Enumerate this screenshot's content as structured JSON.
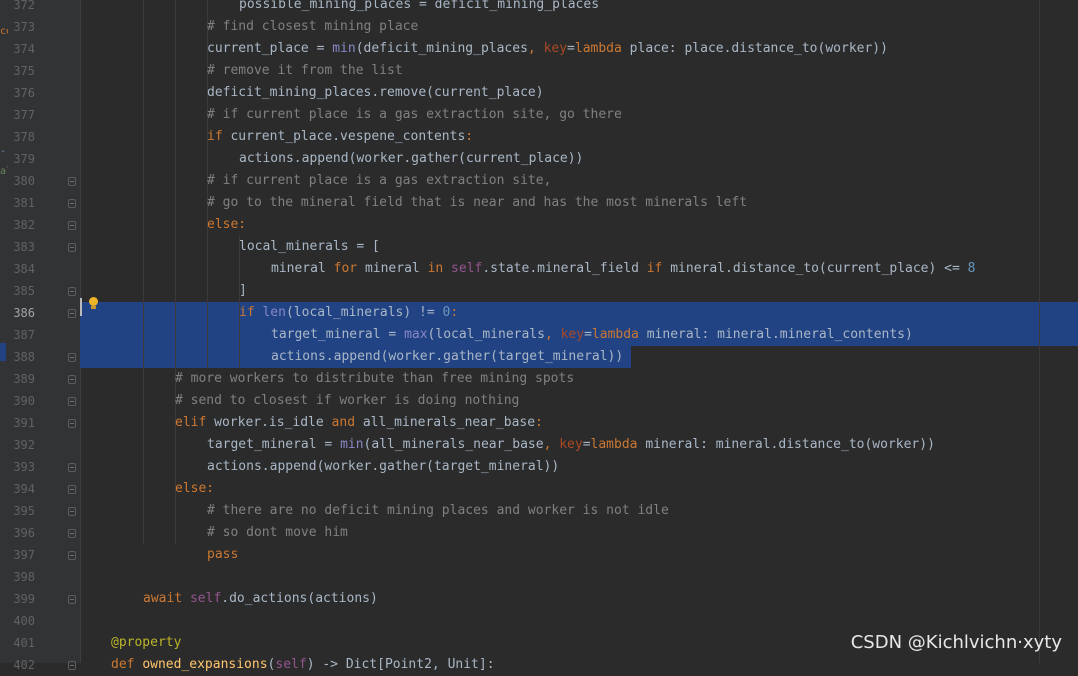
{
  "editor": {
    "current_line": 386,
    "lines": [
      {
        "n": 372,
        "indent": 4,
        "fold": false,
        "tokens": [
          [
            "",
            "possible_mining_places = deficit_mining_places"
          ]
        ]
      },
      {
        "n": 373,
        "indent": 3,
        "fold": false,
        "tokens": [
          [
            "cm",
            "# find closest mining place"
          ]
        ]
      },
      {
        "n": 374,
        "indent": 3,
        "fold": false,
        "tokens": [
          [
            "",
            "current_place = "
          ],
          [
            "fn",
            "min"
          ],
          [
            "",
            "(deficit_mining_places"
          ],
          [
            "kw",
            ", "
          ],
          [
            "pm",
            "key"
          ],
          [
            "",
            "="
          ],
          [
            "kw",
            "lambda "
          ],
          [
            "",
            "place: place.distance_to(worker))"
          ]
        ]
      },
      {
        "n": 375,
        "indent": 3,
        "fold": false,
        "tokens": [
          [
            "cm",
            "# remove it from the list"
          ]
        ]
      },
      {
        "n": 376,
        "indent": 3,
        "fold": false,
        "tokens": [
          [
            "",
            "deficit_mining_places.remove(current_place)"
          ]
        ]
      },
      {
        "n": 377,
        "indent": 3,
        "fold": false,
        "tokens": [
          [
            "cm",
            "# if current place is a gas extraction site, go there"
          ]
        ]
      },
      {
        "n": 378,
        "indent": 3,
        "fold": false,
        "tokens": [
          [
            "kw",
            "if "
          ],
          [
            "",
            "current_place.vespene_contents"
          ],
          [
            "kw",
            ":"
          ]
        ]
      },
      {
        "n": 379,
        "indent": 4,
        "fold": false,
        "tokens": [
          [
            "",
            "actions.append(worker.gather(current_place))"
          ]
        ]
      },
      {
        "n": 380,
        "indent": 3,
        "fold": true,
        "tokens": [
          [
            "cm",
            "# if current place is a gas extraction site,"
          ]
        ]
      },
      {
        "n": 381,
        "indent": 3,
        "fold": true,
        "tokens": [
          [
            "cm",
            "# go to the mineral field that is near and has the most minerals left"
          ]
        ]
      },
      {
        "n": 382,
        "indent": 3,
        "fold": true,
        "tokens": [
          [
            "kw",
            "else:"
          ]
        ]
      },
      {
        "n": 383,
        "indent": 4,
        "fold": true,
        "tokens": [
          [
            "",
            "local_minerals = ["
          ]
        ]
      },
      {
        "n": 384,
        "indent": 5,
        "fold": false,
        "tokens": [
          [
            "",
            "mineral "
          ],
          [
            "kw",
            "for "
          ],
          [
            "",
            "mineral "
          ],
          [
            "kw",
            "in "
          ],
          [
            "sf",
            "self"
          ],
          [
            "",
            ".state.mineral_field "
          ],
          [
            "kw",
            "if "
          ],
          [
            "",
            "mineral.distance_to(current_place) <= "
          ],
          [
            "num",
            "8"
          ]
        ]
      },
      {
        "n": 385,
        "indent": 4,
        "fold": true,
        "tokens": [
          [
            "",
            "]"
          ]
        ]
      },
      {
        "n": 386,
        "indent": 4,
        "fold": true,
        "tokens": [
          [
            "kw",
            "if "
          ],
          [
            "fn",
            "len"
          ],
          [
            "",
            "(local_minerals) != "
          ],
          [
            "num",
            "0"
          ],
          [
            "kw",
            ":"
          ]
        ]
      },
      {
        "n": 387,
        "indent": 5,
        "fold": false,
        "tokens": [
          [
            "",
            "target_mineral = "
          ],
          [
            "fn",
            "max"
          ],
          [
            "",
            "(local_minerals"
          ],
          [
            "kw",
            ", "
          ],
          [
            "pm",
            "key"
          ],
          [
            "",
            "="
          ],
          [
            "kw",
            "lambda "
          ],
          [
            "",
            "mineral: mineral.mineral_contents)"
          ]
        ]
      },
      {
        "n": 388,
        "indent": 5,
        "fold": true,
        "tokens": [
          [
            "",
            "actions.append(worker.gather(target_mineral))"
          ]
        ]
      },
      {
        "n": 389,
        "indent": 2,
        "fold": true,
        "tokens": [
          [
            "cm",
            "# more workers to distribute than free mining spots"
          ]
        ]
      },
      {
        "n": 390,
        "indent": 2,
        "fold": true,
        "tokens": [
          [
            "cm",
            "# send to closest if worker is doing nothing"
          ]
        ]
      },
      {
        "n": 391,
        "indent": 2,
        "fold": true,
        "tokens": [
          [
            "kw",
            "elif "
          ],
          [
            "",
            "worker.is_idle "
          ],
          [
            "kw",
            "and "
          ],
          [
            "",
            "all_minerals_near_base"
          ],
          [
            "kw",
            ":"
          ]
        ]
      },
      {
        "n": 392,
        "indent": 3,
        "fold": false,
        "tokens": [
          [
            "",
            "target_mineral = "
          ],
          [
            "fn",
            "min"
          ],
          [
            "",
            "(all_minerals_near_base"
          ],
          [
            "kw",
            ", "
          ],
          [
            "pm",
            "key"
          ],
          [
            "",
            "="
          ],
          [
            "kw",
            "lambda "
          ],
          [
            "",
            "mineral: mineral.distance_to(worker))"
          ]
        ]
      },
      {
        "n": 393,
        "indent": 3,
        "fold": true,
        "tokens": [
          [
            "",
            "actions.append(worker.gather(target_mineral))"
          ]
        ]
      },
      {
        "n": 394,
        "indent": 2,
        "fold": true,
        "tokens": [
          [
            "kw",
            "else:"
          ]
        ]
      },
      {
        "n": 395,
        "indent": 3,
        "fold": true,
        "tokens": [
          [
            "cm",
            "# there are no deficit mining places and worker is not idle"
          ]
        ]
      },
      {
        "n": 396,
        "indent": 3,
        "fold": true,
        "tokens": [
          [
            "cm",
            "# so dont move him"
          ]
        ]
      },
      {
        "n": 397,
        "indent": 3,
        "fold": true,
        "tokens": [
          [
            "kw",
            "pass"
          ]
        ]
      },
      {
        "n": 398,
        "indent": 0,
        "fold": false,
        "tokens": []
      },
      {
        "n": 399,
        "indent": 1,
        "fold": true,
        "tokens": [
          [
            "kw",
            "await "
          ],
          [
            "sf",
            "self"
          ],
          [
            "",
            ".do_actions(actions)"
          ]
        ]
      },
      {
        "n": 400,
        "indent": 0,
        "fold": false,
        "tokens": []
      },
      {
        "n": 401,
        "indent": 0,
        "fold": false,
        "tokens": [
          [
            "dec",
            "@property"
          ]
        ]
      },
      {
        "n": 402,
        "indent": 0,
        "fold": true,
        "tokens": [
          [
            "kw",
            "def "
          ],
          [
            "def",
            "owned_expansions"
          ],
          [
            "",
            "("
          ],
          [
            "sf",
            "self"
          ],
          [
            "",
            ") -> Dict[Point2, Unit]:"
          ]
        ]
      }
    ]
  },
  "side_fragments": [
    "co",
    "-",
    "al"
  ],
  "colors": {
    "background": "#2b2b2b",
    "gutter": "#313335",
    "selection": "#214283",
    "keyword": "#cc7832",
    "comment": "#808080",
    "builtin": "#8888c6",
    "self": "#94558d",
    "param": "#aa4926",
    "number": "#6897bb",
    "decorator": "#bbb529",
    "function_def": "#ffc66d",
    "text": "#a9b7c6"
  },
  "watermark": "CSDN @Kichlvichn·xyty"
}
